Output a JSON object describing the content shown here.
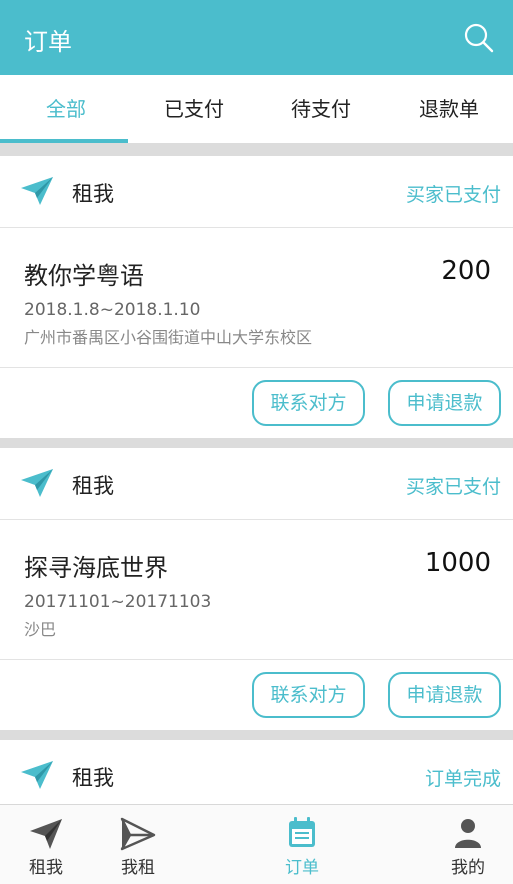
{
  "appbar": {
    "title": "订单"
  },
  "tabs": [
    {
      "label": "全部",
      "active": true
    },
    {
      "label": "已支付"
    },
    {
      "label": "待支付"
    },
    {
      "label": "退款单"
    }
  ],
  "orders": [
    {
      "seller": "租我",
      "status": "买家已支付",
      "title": "教你学粤语",
      "price": "200",
      "dates": "2018.1.8~2018.1.10",
      "address": "广州市番禺区小谷围街道中山大学东校区",
      "contact_label": "联系对方",
      "refund_label": "申请退款"
    },
    {
      "seller": "租我",
      "status": "买家已支付",
      "title": "探寻海底世界",
      "price": "1000",
      "dates": "20171101~20171103",
      "address": "沙巴",
      "contact_label": "联系对方",
      "refund_label": "申请退款"
    },
    {
      "seller": "租我",
      "status": "订单完成"
    }
  ],
  "bottom_nav": [
    {
      "label": "租我",
      "icon": "paper-plane-icon"
    },
    {
      "label": "我租",
      "icon": "paper-plane-outline-icon"
    },
    {
      "label": "订单",
      "icon": "calendar-icon",
      "active": true
    },
    {
      "label": "我的",
      "icon": "person-icon"
    }
  ],
  "colors": {
    "accent": "#4bbdcc",
    "divider": "#dcdcdc"
  }
}
